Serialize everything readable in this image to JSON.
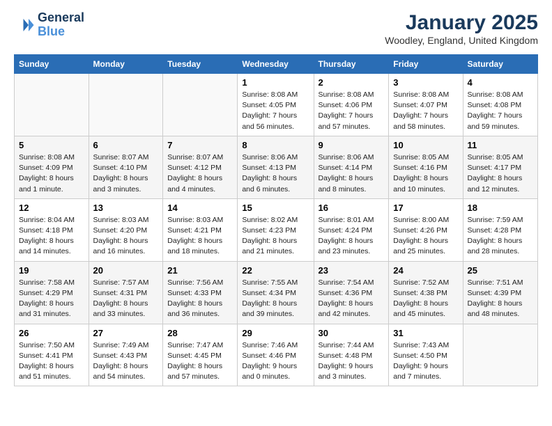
{
  "header": {
    "logo_line1": "General",
    "logo_line2": "Blue",
    "month_title": "January 2025",
    "location": "Woodley, England, United Kingdom"
  },
  "weekdays": [
    "Sunday",
    "Monday",
    "Tuesday",
    "Wednesday",
    "Thursday",
    "Friday",
    "Saturday"
  ],
  "weeks": [
    [
      {
        "day": "",
        "info": ""
      },
      {
        "day": "",
        "info": ""
      },
      {
        "day": "",
        "info": ""
      },
      {
        "day": "1",
        "info": "Sunrise: 8:08 AM\nSunset: 4:05 PM\nDaylight: 7 hours and 56 minutes."
      },
      {
        "day": "2",
        "info": "Sunrise: 8:08 AM\nSunset: 4:06 PM\nDaylight: 7 hours and 57 minutes."
      },
      {
        "day": "3",
        "info": "Sunrise: 8:08 AM\nSunset: 4:07 PM\nDaylight: 7 hours and 58 minutes."
      },
      {
        "day": "4",
        "info": "Sunrise: 8:08 AM\nSunset: 4:08 PM\nDaylight: 7 hours and 59 minutes."
      }
    ],
    [
      {
        "day": "5",
        "info": "Sunrise: 8:08 AM\nSunset: 4:09 PM\nDaylight: 8 hours and 1 minute."
      },
      {
        "day": "6",
        "info": "Sunrise: 8:07 AM\nSunset: 4:10 PM\nDaylight: 8 hours and 3 minutes."
      },
      {
        "day": "7",
        "info": "Sunrise: 8:07 AM\nSunset: 4:12 PM\nDaylight: 8 hours and 4 minutes."
      },
      {
        "day": "8",
        "info": "Sunrise: 8:06 AM\nSunset: 4:13 PM\nDaylight: 8 hours and 6 minutes."
      },
      {
        "day": "9",
        "info": "Sunrise: 8:06 AM\nSunset: 4:14 PM\nDaylight: 8 hours and 8 minutes."
      },
      {
        "day": "10",
        "info": "Sunrise: 8:05 AM\nSunset: 4:16 PM\nDaylight: 8 hours and 10 minutes."
      },
      {
        "day": "11",
        "info": "Sunrise: 8:05 AM\nSunset: 4:17 PM\nDaylight: 8 hours and 12 minutes."
      }
    ],
    [
      {
        "day": "12",
        "info": "Sunrise: 8:04 AM\nSunset: 4:18 PM\nDaylight: 8 hours and 14 minutes."
      },
      {
        "day": "13",
        "info": "Sunrise: 8:03 AM\nSunset: 4:20 PM\nDaylight: 8 hours and 16 minutes."
      },
      {
        "day": "14",
        "info": "Sunrise: 8:03 AM\nSunset: 4:21 PM\nDaylight: 8 hours and 18 minutes."
      },
      {
        "day": "15",
        "info": "Sunrise: 8:02 AM\nSunset: 4:23 PM\nDaylight: 8 hours and 21 minutes."
      },
      {
        "day": "16",
        "info": "Sunrise: 8:01 AM\nSunset: 4:24 PM\nDaylight: 8 hours and 23 minutes."
      },
      {
        "day": "17",
        "info": "Sunrise: 8:00 AM\nSunset: 4:26 PM\nDaylight: 8 hours and 25 minutes."
      },
      {
        "day": "18",
        "info": "Sunrise: 7:59 AM\nSunset: 4:28 PM\nDaylight: 8 hours and 28 minutes."
      }
    ],
    [
      {
        "day": "19",
        "info": "Sunrise: 7:58 AM\nSunset: 4:29 PM\nDaylight: 8 hours and 31 minutes."
      },
      {
        "day": "20",
        "info": "Sunrise: 7:57 AM\nSunset: 4:31 PM\nDaylight: 8 hours and 33 minutes."
      },
      {
        "day": "21",
        "info": "Sunrise: 7:56 AM\nSunset: 4:33 PM\nDaylight: 8 hours and 36 minutes."
      },
      {
        "day": "22",
        "info": "Sunrise: 7:55 AM\nSunset: 4:34 PM\nDaylight: 8 hours and 39 minutes."
      },
      {
        "day": "23",
        "info": "Sunrise: 7:54 AM\nSunset: 4:36 PM\nDaylight: 8 hours and 42 minutes."
      },
      {
        "day": "24",
        "info": "Sunrise: 7:52 AM\nSunset: 4:38 PM\nDaylight: 8 hours and 45 minutes."
      },
      {
        "day": "25",
        "info": "Sunrise: 7:51 AM\nSunset: 4:39 PM\nDaylight: 8 hours and 48 minutes."
      }
    ],
    [
      {
        "day": "26",
        "info": "Sunrise: 7:50 AM\nSunset: 4:41 PM\nDaylight: 8 hours and 51 minutes."
      },
      {
        "day": "27",
        "info": "Sunrise: 7:49 AM\nSunset: 4:43 PM\nDaylight: 8 hours and 54 minutes."
      },
      {
        "day": "28",
        "info": "Sunrise: 7:47 AM\nSunset: 4:45 PM\nDaylight: 8 hours and 57 minutes."
      },
      {
        "day": "29",
        "info": "Sunrise: 7:46 AM\nSunset: 4:46 PM\nDaylight: 9 hours and 0 minutes."
      },
      {
        "day": "30",
        "info": "Sunrise: 7:44 AM\nSunset: 4:48 PM\nDaylight: 9 hours and 3 minutes."
      },
      {
        "day": "31",
        "info": "Sunrise: 7:43 AM\nSunset: 4:50 PM\nDaylight: 9 hours and 7 minutes."
      },
      {
        "day": "",
        "info": ""
      }
    ]
  ]
}
